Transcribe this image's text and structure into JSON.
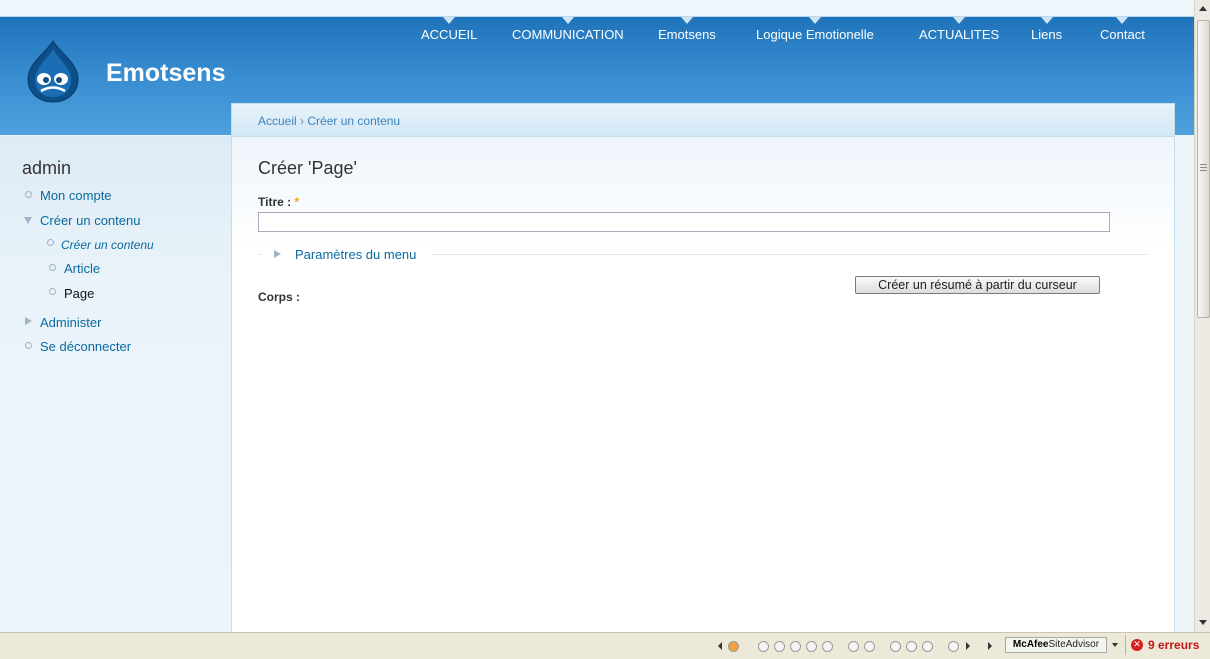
{
  "site": {
    "name": "Emotsens"
  },
  "nav": {
    "items": [
      "ACCUEIL",
      "COMMUNICATION",
      "Emotsens",
      "Logique Emotionelle",
      "ACTUALITES",
      "Liens",
      "Contact"
    ]
  },
  "sidebar": {
    "title": "admin",
    "items": [
      {
        "label": "Mon compte"
      },
      {
        "label": "Créer un contenu"
      },
      {
        "label": "Créer un contenu"
      },
      {
        "label": "Article"
      },
      {
        "label": "Page"
      },
      {
        "label": "Administer"
      },
      {
        "label": "Se déconnecter"
      }
    ]
  },
  "breadcrumb": {
    "home": "Accueil",
    "separator": "›",
    "current": "Créer un contenu"
  },
  "page": {
    "title": "Créer 'Page'"
  },
  "form": {
    "title_label": "Titre :",
    "required_mark": "*",
    "title_value": "",
    "menu_settings_label": "Paramètres du menu",
    "summary_button": "Créer un résumé à partir du curseur",
    "body_label": "Corps :"
  },
  "statusbar": {
    "mcafee_brand": "McAfee",
    "mcafee_product": "SiteAdvisor",
    "errors": "9 erreurs"
  },
  "colors": {
    "header": "#3b8fd2",
    "link": "#0a6aa1",
    "error": "#c21818",
    "required": "#f19c0c"
  },
  "icons": {
    "logo": "drupal-drop-icon",
    "scroll_up": "scroll-up-icon",
    "scroll_down": "scroll-down-icon",
    "error": "error-icon"
  }
}
